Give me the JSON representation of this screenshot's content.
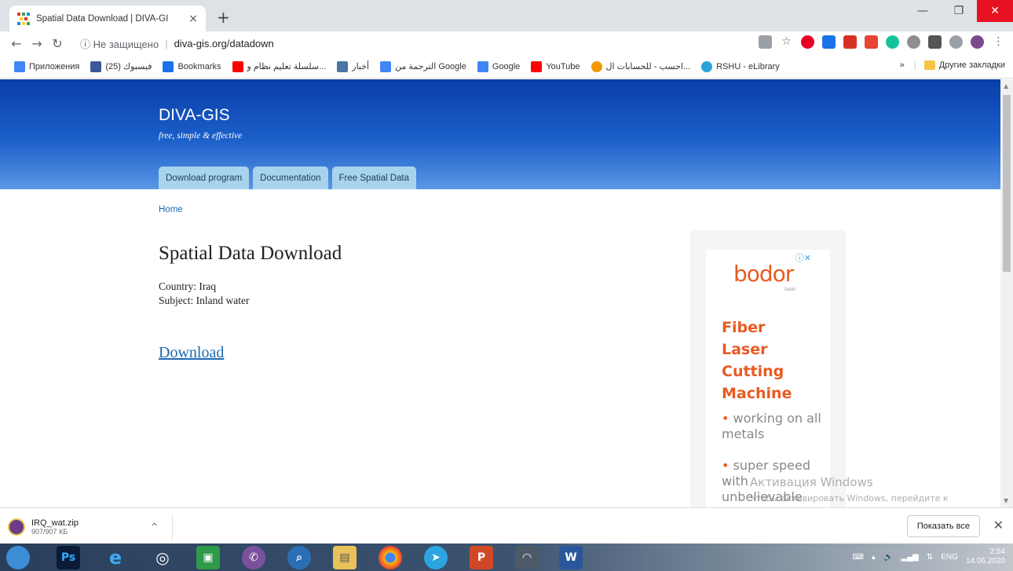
{
  "browser": {
    "tab_title": "Spatial Data Download | DIVA-GI",
    "tab_close": "×",
    "new_tab": "+",
    "insecure_label": "ⓘ Не защищено",
    "separator": "|",
    "url": "diva-gis.org/datadown",
    "bookmarks": [
      {
        "label": "Приложения",
        "icon": "apps-icon",
        "color": "#4285f4"
      },
      {
        "label": "فيسبوك (25)",
        "icon": "facebook-icon",
        "color": "#3b5998"
      },
      {
        "label": "Bookmarks",
        "icon": "star-icon",
        "color": "#1a73e8"
      },
      {
        "label": "سلسلة تعليم نظام و...",
        "icon": "youtube-icon",
        "color": "#ff0000"
      },
      {
        "label": "أخبار",
        "icon": "vk-icon",
        "color": "#4a76a8"
      },
      {
        "label": "الترجمة من Google",
        "icon": "translate-icon",
        "color": "#4285f4"
      },
      {
        "label": "Google",
        "icon": "google-icon",
        "color": "#4285f4"
      },
      {
        "label": "YouTube",
        "icon": "youtube-icon",
        "color": "#ff0000"
      },
      {
        "label": "احسب - للحسابات ال...",
        "icon": "calc-icon",
        "color": "#f29900"
      },
      {
        "label": "RSHU - eLibrary",
        "icon": "elibrary-icon",
        "color": "#29a3d9"
      }
    ],
    "more_bookmarks": "»",
    "other_bookmarks": "Другие закладки"
  },
  "page": {
    "site_name": "DIVA-GIS",
    "slogan": "free, simple & effective",
    "nav_tabs": [
      "Download program",
      "Documentation",
      "Free Spatial Data"
    ],
    "breadcrumb": "Home",
    "title": "Spatial Data Download",
    "country": "Country: Iraq",
    "subject": "Subject: Inland water",
    "download_link": "Download"
  },
  "ad": {
    "close": "ⓘ✕",
    "logo": "bodor",
    "logo_sub": "laser",
    "headline": [
      "Fiber",
      "Laser",
      "Cutting",
      "Machine"
    ],
    "bullets": [
      "working on all metals",
      "super speed with unbelievable"
    ]
  },
  "watermark": {
    "line1": "Активация Windows",
    "line2": "Чтобы активировать Windows, перейдите к параметрам компьютера."
  },
  "download_shelf": {
    "file_name": "IRQ_wat.zip",
    "file_size": "907/907 КБ",
    "show_all": "Показать все",
    "close": "✕"
  },
  "taskbar": {
    "time": "2:54",
    "date": "14.06.2020",
    "lang": "ENG",
    "apps": [
      {
        "name": "start-button",
        "color": "#3c8dd6",
        "glyph": ""
      },
      {
        "name": "photoshop-app",
        "color": "#0b1b35",
        "glyph": "Ps"
      },
      {
        "name": "ie-app",
        "color": "#1e88e5",
        "glyph": "e"
      },
      {
        "name": "opera-app",
        "color": "#5c6a7a",
        "glyph": "◎"
      },
      {
        "name": "store-app",
        "color": "#2e9a4a",
        "glyph": "▣"
      },
      {
        "name": "viber-app",
        "color": "#7b519d",
        "glyph": "✆"
      },
      {
        "name": "search-app",
        "color": "#2a6fb6",
        "glyph": "⌕"
      },
      {
        "name": "explorer-app",
        "color": "#e8c15a",
        "glyph": "▤"
      },
      {
        "name": "chrome-app",
        "color": "#e0463c",
        "glyph": "●"
      },
      {
        "name": "telegram-app",
        "color": "#2ca5e0",
        "glyph": "➤"
      },
      {
        "name": "powerpoint-app",
        "color": "#d24726",
        "glyph": "P"
      },
      {
        "name": "globalmapper-app",
        "color": "#4d5a66",
        "glyph": "◠"
      },
      {
        "name": "word-app",
        "color": "#2b579a",
        "glyph": "W"
      }
    ]
  }
}
